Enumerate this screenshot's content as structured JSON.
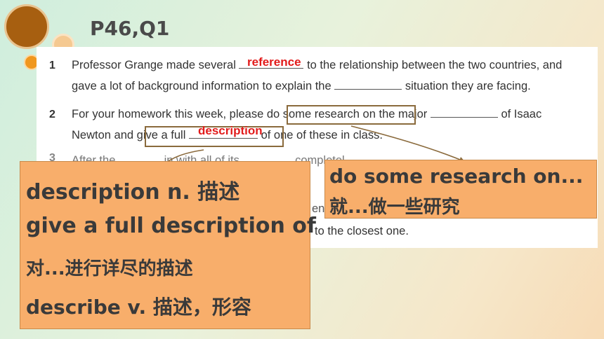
{
  "slide": {
    "title": "P46,Q1"
  },
  "worksheet": {
    "q1": {
      "number": "1",
      "line1_a": "Professor Grange made several",
      "line1_b": "to the relationship between the two countries, and",
      "line2_a": "gave a lot of background information to explain the",
      "line2_b": "situation they are facing.",
      "answer": "reference"
    },
    "q2": {
      "number": "2",
      "line1_a": "For your homework this week, please",
      "line1_highlight": "do some research on",
      "line1_b": "the major",
      "line1_c": "of Isaac",
      "line2_a": "Newton and",
      "line2_highlight": "give a full",
      "line2_b": "of one of these in class.",
      "answer": "description"
    },
    "q3": {
      "number": "3",
      "line1_a": "After the",
      "line1_b": "in",
      "line1_c": "with all of its",
      "line1_d": "completel",
      "line2_fragment": "ent",
      "line3_fragment": "to the closest one."
    }
  },
  "notes": {
    "left": {
      "line1": "description n. 描述",
      "line2": "give a full description of",
      "line3": "对...进行详尽的描述",
      "line4": "describe v. 描述，形容"
    },
    "right": {
      "line1": "do some research on...",
      "line2": "就...做一些研究"
    }
  },
  "colors": {
    "accent_red": "#e21b1b",
    "note_bg": "#f8ae6b",
    "title": "#4a4a4a"
  }
}
